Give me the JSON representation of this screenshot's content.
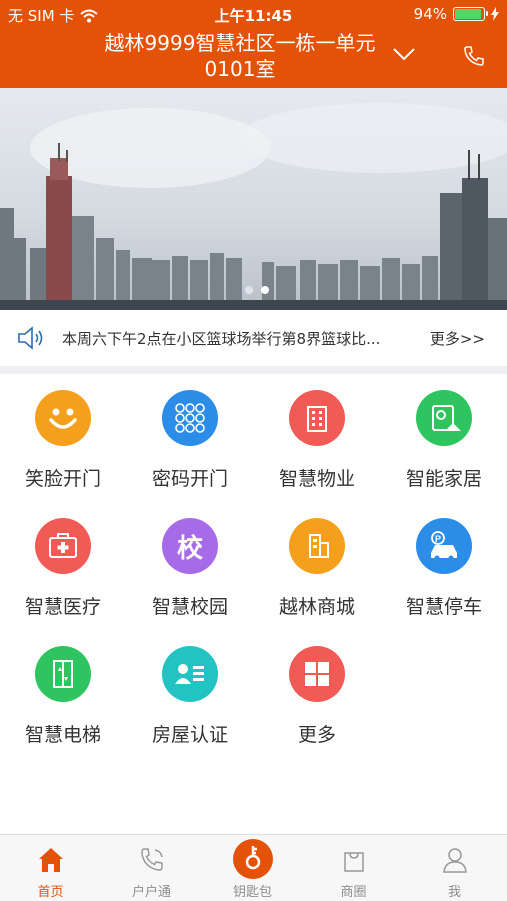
{
  "status": {
    "carrier": "无 SIM 卡",
    "time": "上午11:45",
    "battery": "94%",
    "battery_level": 0.94
  },
  "header": {
    "title": "越林9999智慧社区一栋一单元0101室"
  },
  "banner": {
    "dots": 2,
    "active": 1
  },
  "notice": {
    "text": "本周六下午2点在小区篮球场举行第8界篮球比...",
    "more": "更多>>"
  },
  "services": [
    {
      "label": "笑脸开门",
      "icon": "smiley-icon",
      "color": "#F5A01C"
    },
    {
      "label": "密码开门",
      "icon": "keypad-icon",
      "color": "#2B8DE8"
    },
    {
      "label": "智慧物业",
      "icon": "building-icon",
      "color": "#F25A55"
    },
    {
      "label": "智能家居",
      "icon": "smart-home-icon",
      "color": "#2EC45F"
    },
    {
      "label": "智慧医疗",
      "icon": "medical-kit-icon",
      "color": "#F25A55"
    },
    {
      "label": "智慧校园",
      "icon": "school-icon",
      "color": "#A86BE8",
      "glyph": "校"
    },
    {
      "label": "越林商城",
      "icon": "mall-icon",
      "color": "#F5A01C"
    },
    {
      "label": "智慧停车",
      "icon": "parking-car-icon",
      "color": "#2B8DE8"
    },
    {
      "label": "智慧电梯",
      "icon": "elevator-icon",
      "color": "#2EC45F"
    },
    {
      "label": "房屋认证",
      "icon": "id-card-icon",
      "color": "#23C3C3"
    },
    {
      "label": "更多",
      "icon": "grid-more-icon",
      "color": "#F25A55"
    }
  ],
  "tabs": [
    {
      "label": "首页",
      "icon": "home-icon"
    },
    {
      "label": "户户通",
      "icon": "phone-icon"
    },
    {
      "label": "钥匙包",
      "icon": "key-icon"
    },
    {
      "label": "商圈",
      "icon": "bag-icon"
    },
    {
      "label": "我",
      "icon": "user-icon"
    }
  ],
  "colors": {
    "brand": "#E35206"
  }
}
